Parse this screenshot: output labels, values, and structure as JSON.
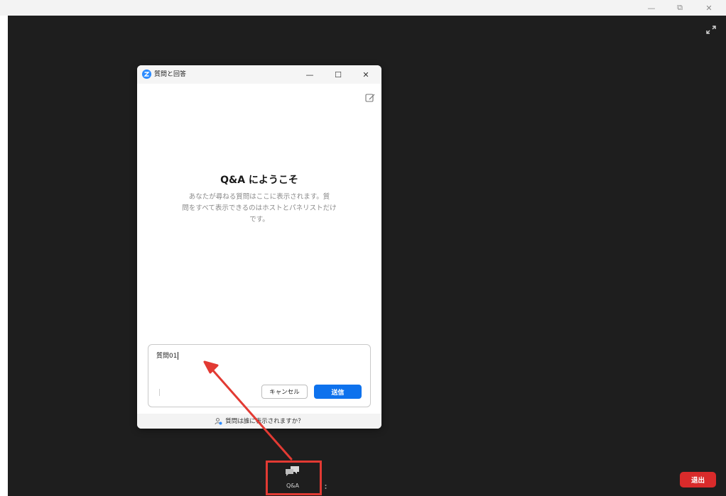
{
  "host_window": {
    "minimize_glyph": "—",
    "restore_glyph": "⧉",
    "close_glyph": "✕"
  },
  "dialog": {
    "title": "質問と回答",
    "minimize_glyph": "—",
    "maximize_glyph": "☐",
    "close_glyph": "✕",
    "welcome_title": "Q&A にようこそ",
    "welcome_body_lines": [
      "あなたが尋ねる質問はここに表示されます。質",
      "問をすべて表示できるのはホストとパネリストだけ",
      "です。"
    ],
    "compose": {
      "value": "質問01",
      "cancel_label": "キャンセル",
      "send_label": "送信"
    },
    "footer_text": "質問は誰に表示されますか？"
  },
  "toolbar": {
    "qa_label": "Q&A",
    "leave_label": "退出"
  },
  "colors": {
    "meeting_bg": "#1e1e1e",
    "accent_blue": "#0e72ed",
    "leave_red": "#d92b2b",
    "annotation_red": "#e23a33"
  },
  "icons": {
    "fullscreen": "expand-icon",
    "edit": "edit-icon",
    "logo": "zoom-logo-icon",
    "qa": "qa-chat-icon",
    "person": "person-icon"
  }
}
